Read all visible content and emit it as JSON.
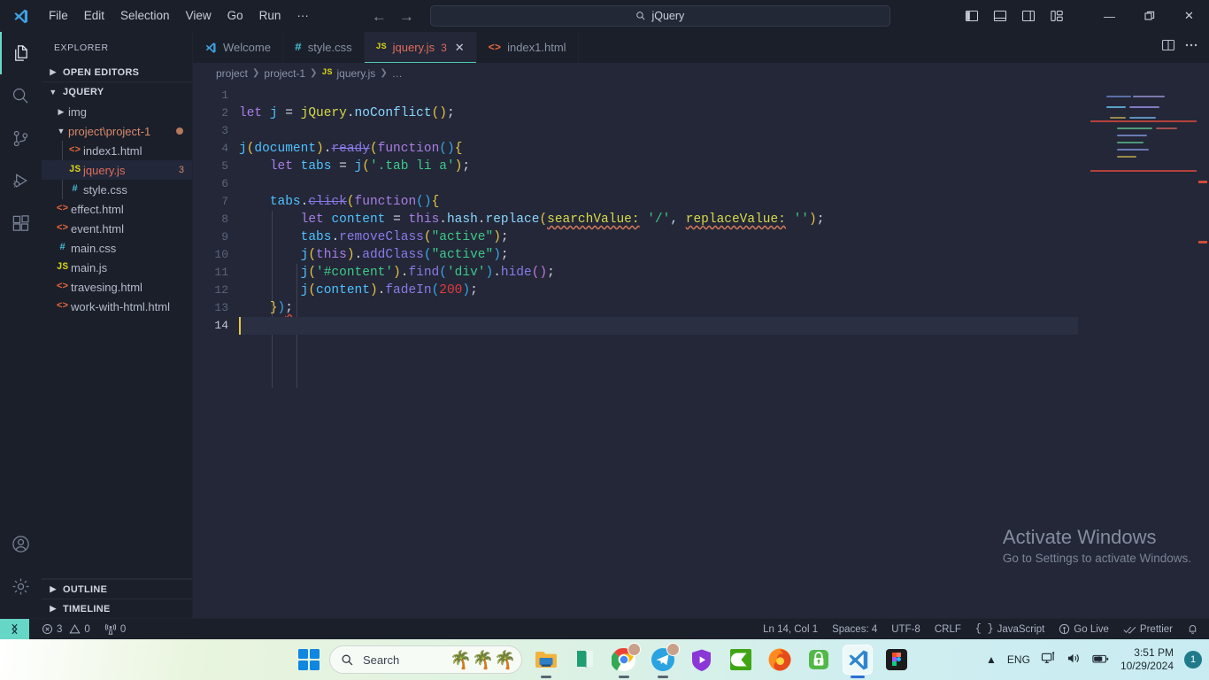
{
  "titlebar": {
    "logo_icon": "vscode-logo-icon",
    "menu": [
      "File",
      "Edit",
      "Selection",
      "View",
      "Go",
      "Run",
      "···"
    ],
    "back_icon": "arrow-left-icon",
    "forward_icon": "arrow-right-icon",
    "command_center": {
      "icon": "search-icon",
      "value": "jQuery"
    },
    "layout_icons": [
      "toggle-primary-sidebar-icon",
      "toggle-panel-icon",
      "toggle-secondary-sidebar-icon",
      "customize-layout-icon"
    ],
    "window_controls": {
      "minimize": "—",
      "maximize": "restore-icon",
      "close": "✕"
    }
  },
  "activitybar": {
    "items": [
      {
        "name": "explorer",
        "icon": "files-icon",
        "active": true
      },
      {
        "name": "search",
        "icon": "search-icon",
        "active": false
      },
      {
        "name": "source-control",
        "icon": "source-control-icon",
        "active": false
      },
      {
        "name": "run-and-debug",
        "icon": "run-debug-icon",
        "active": false
      },
      {
        "name": "extensions",
        "icon": "extensions-icon",
        "active": false
      }
    ],
    "bottom": [
      {
        "name": "accounts",
        "icon": "account-icon"
      },
      {
        "name": "manage",
        "icon": "gear-icon"
      }
    ]
  },
  "sidebar": {
    "title": "EXPLORER",
    "more_actions_icon": "ellipsis-icon",
    "open_editors": {
      "label": "OPEN EDITORS",
      "expanded": false
    },
    "root": {
      "label": "JQUERY",
      "expanded": true
    },
    "tree": [
      {
        "label": "img",
        "type": "folder",
        "depth": 1,
        "expanded": false
      },
      {
        "label": "project\\project-1",
        "type": "folder",
        "depth": 1,
        "expanded": true,
        "modified": true
      },
      {
        "label": "index1.html",
        "type": "html",
        "depth": 2
      },
      {
        "label": "jquery.js",
        "type": "js",
        "depth": 2,
        "selected": true,
        "badge": "3",
        "error": true
      },
      {
        "label": "style.css",
        "type": "css",
        "depth": 2
      },
      {
        "label": "effect.html",
        "type": "html",
        "depth": 1
      },
      {
        "label": "event.html",
        "type": "html",
        "depth": 1
      },
      {
        "label": "main.css",
        "type": "css",
        "depth": 1
      },
      {
        "label": "main.js",
        "type": "js",
        "depth": 1
      },
      {
        "label": "travesing.html",
        "type": "html",
        "depth": 1
      },
      {
        "label": "work-with-html.html",
        "type": "html",
        "depth": 1
      }
    ],
    "bottom_sections": [
      {
        "label": "OUTLINE",
        "expanded": false
      },
      {
        "label": "TIMELINE",
        "expanded": false
      }
    ]
  },
  "editor": {
    "tabs": [
      {
        "label": "Welcome",
        "icon": "vscode-logo-icon",
        "active": false
      },
      {
        "label": "style.css",
        "icon": "css-icon",
        "active": false
      },
      {
        "label": "jquery.js",
        "icon": "js-icon",
        "active": true,
        "badge": "3",
        "close_icon": "close-icon"
      },
      {
        "label": "index1.html",
        "icon": "html-icon",
        "active": false
      }
    ],
    "tabs_actions": [
      "split-editor-icon",
      "more-actions-icon"
    ],
    "breadcrumbs": [
      "project",
      "project-1",
      "jquery.js",
      "…"
    ],
    "breadcrumb_file_icon": "js-icon",
    "line_numbers": [
      "1",
      "2",
      "3",
      "4",
      "5",
      "6",
      "7",
      "8",
      "9",
      "10",
      "11",
      "12",
      "13",
      "14"
    ],
    "active_line": 14,
    "code_lines": [
      "",
      "let j = jQuery.noConflict();",
      "",
      "j(document).ready(function(){",
      "    let tabs = j('.tab li a');",
      "",
      "    tabs.click(function(){",
      "        let content = this.hash.replace(searchValue: '/', replaceValue: '');",
      "        tabs.removeClass(\"active\");",
      "        j(this).addClass(\"active\");",
      "        j('#content').find('div').hide();",
      "        j(content).fadeIn(200);",
      "    });",
      ""
    ]
  },
  "watermark": {
    "title": "Activate Windows",
    "subtitle": "Go to Settings to activate Windows."
  },
  "statusbar": {
    "remote_icon": "remote-window-icon",
    "errors_icon": "error-icon",
    "errors": "3",
    "warnings_icon": "warning-icon",
    "warnings": "0",
    "ports_icon": "radio-tower-icon",
    "ports": "0",
    "position": "Ln 14, Col 1",
    "indentation": "Spaces: 4",
    "encoding": "UTF-8",
    "eol": "CRLF",
    "language_icon": "braces-icon",
    "language": "JavaScript",
    "golive_icon": "broadcast-icon",
    "golive": "Go Live",
    "prettier_icon": "check-check-icon",
    "prettier": "Prettier",
    "bell_icon": "bell-icon"
  },
  "taskbar": {
    "start_icon": "windows-start-icon",
    "search": {
      "icon": "search-icon",
      "placeholder": "Search",
      "widget_icon": "weather-widget-icon"
    },
    "apps": [
      {
        "name": "file-explorer",
        "icon": "folder-icon",
        "running": true
      },
      {
        "name": "book-app",
        "icon": "book-icon",
        "running": false
      },
      {
        "name": "google-chrome",
        "icon": "chrome-icon",
        "running": true
      },
      {
        "name": "telegram",
        "icon": "telegram-icon",
        "running": true
      },
      {
        "name": "video-shield-app",
        "icon": "shield-play-icon",
        "running": false
      },
      {
        "name": "camtasia",
        "icon": "camtasia-icon",
        "running": false
      },
      {
        "name": "firefox",
        "icon": "firefox-icon",
        "running": false
      },
      {
        "name": "vpn-app",
        "icon": "lock-icon",
        "running": false
      },
      {
        "name": "visual-studio-code",
        "icon": "vscode-icon",
        "running": true,
        "active": true
      },
      {
        "name": "figma",
        "icon": "figma-icon",
        "running": false
      }
    ],
    "tray": {
      "chevron_icon": "chevron-up-icon",
      "language": "ENG",
      "network_icon": "network-icon",
      "volume_icon": "volume-icon",
      "battery_icon": "battery-charging-icon",
      "time": "3:51 PM",
      "date": "10/29/2024",
      "notification_count": "1"
    }
  },
  "colors": {
    "accent_teal": "#4ec9b0",
    "error_red": "#e06c5a",
    "titlebar_bg": "#1b1f2a",
    "editor_bg": "#232737",
    "cursor": "#e8c547"
  }
}
